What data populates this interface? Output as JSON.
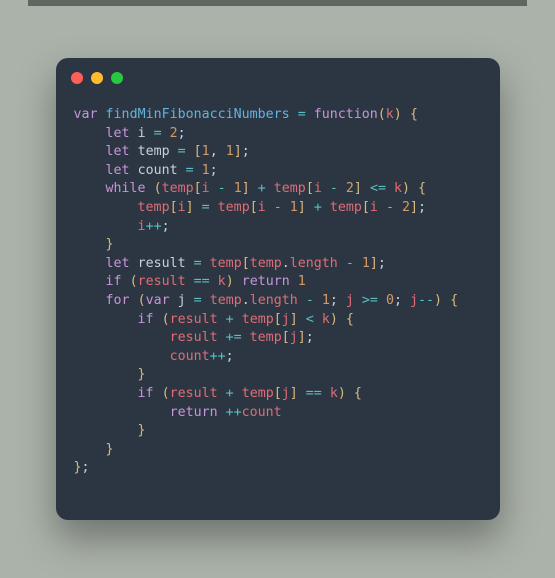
{
  "traffic_colors": {
    "close": "#ff5f57",
    "min": "#febc2e",
    "max": "#28c840"
  },
  "code": {
    "fnName": "findMinFibonacciNumbers",
    "param": "k",
    "i": "i",
    "j": "j",
    "temp": "temp",
    "count": "count",
    "result": "result",
    "length": "length",
    "kw_var": "var",
    "kw_let": "let",
    "kw_function": "function",
    "kw_while": "while",
    "kw_if": "if",
    "kw_return": "return",
    "kw_for": "for",
    "num_0": "0",
    "num_1": "1",
    "num_2": "2"
  }
}
